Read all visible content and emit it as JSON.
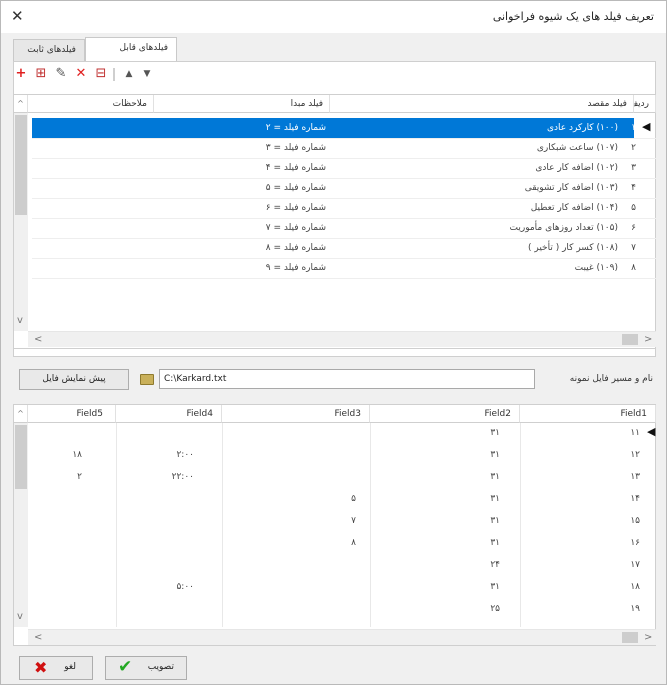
{
  "window": {
    "title": "تعریف فیلد های یک شیوه فراخوانی",
    "close_glyph": "✕"
  },
  "tabs": [
    {
      "label": "فیلدهای قابل تعریف",
      "active": true
    },
    {
      "label": "فیلدهای ثابت",
      "active": false
    }
  ],
  "toolbar": {
    "add_glyph": "+",
    "insert_glyph": "⊞",
    "edit_glyph": "✎",
    "delete_glyph": "✕",
    "clear_glyph": "⊟",
    "up_glyph": "▲",
    "down_glyph": "▼"
  },
  "upper_grid": {
    "headers": {
      "row": "ردیف",
      "target": "فیلد مقصد",
      "source": "فیلد مبدا",
      "notes": "ملاحظات"
    },
    "rows": [
      {
        "row": "۱",
        "target": "(۱۰۰) کارکرد عادی",
        "source": "شماره فیلد = ۲",
        "selected": true
      },
      {
        "row": "۲",
        "target": "(۱۰۷) ساعت شبکاری",
        "source": "شماره فیلد = ۳"
      },
      {
        "row": "۳",
        "target": "(۱۰۲) اضافه کار عادی",
        "source": "شماره فیلد = ۴"
      },
      {
        "row": "۴",
        "target": "(۱۰۳) اضافه کار تشویقی",
        "source": "شماره فیلد = ۵"
      },
      {
        "row": "۵",
        "target": "(۱۰۴) اضافه کار تعطیل",
        "source": "شماره فیلد = ۶"
      },
      {
        "row": "۶",
        "target": "(۱۰۵) تعداد روزهای مأموریت",
        "source": "شماره فیلد = ۷"
      },
      {
        "row": "۷",
        "target": "(۱۰۸) کسر کار ( تأخیر )",
        "source": "شماره فیلد = ۸"
      },
      {
        "row": "۸",
        "target": "(۱۰۹) غیبت",
        "source": "شماره فیلد = ۹"
      }
    ]
  },
  "file": {
    "label": "نام و مسیر فایل نمونه",
    "path": "C:\\Karkard.txt",
    "preview_button": "پیش نمایش فایل"
  },
  "lower_grid": {
    "headers": [
      "Field1",
      "Field2",
      "Field3",
      "Field4",
      "Field5"
    ],
    "rows": [
      [
        "۱۱",
        "۳۱",
        "",
        "",
        ""
      ],
      [
        "۱۲",
        "۳۱",
        "",
        "۲:۰۰",
        "۱۸"
      ],
      [
        "۱۳",
        "۳۱",
        "",
        "۲۲:۰۰",
        "۲"
      ],
      [
        "۱۴",
        "۳۱",
        "۵",
        "",
        ""
      ],
      [
        "۱۵",
        "۳۱",
        "۷",
        "",
        ""
      ],
      [
        "۱۶",
        "۳۱",
        "۸",
        "",
        ""
      ],
      [
        "۱۷",
        "۲۴",
        "",
        "",
        ""
      ],
      [
        "۱۸",
        "۳۱",
        "",
        "۵:۰۰",
        ""
      ],
      [
        "۱۹",
        "۲۵",
        "",
        "",
        ""
      ]
    ]
  },
  "footer": {
    "approve": "تصویب",
    "cancel": "لغو"
  },
  "colors": {
    "selection": "#0078d7",
    "add": "#e02020",
    "delete": "#e02020",
    "approve_check": "#23a823",
    "cancel_x": "#d01010"
  }
}
